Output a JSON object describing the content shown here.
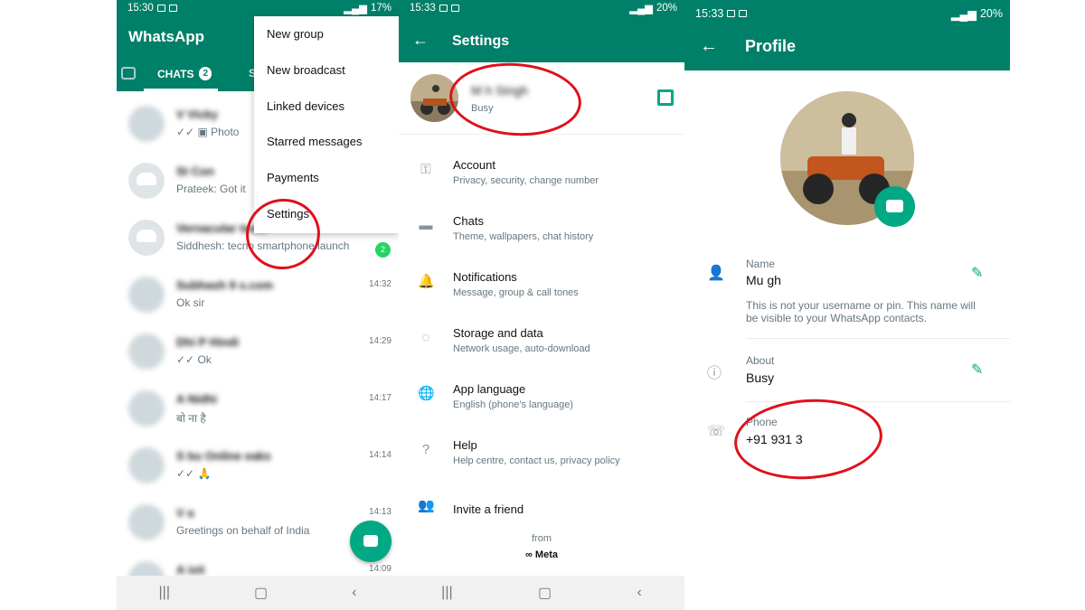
{
  "panel1": {
    "status_time": "15:30",
    "status_battery": "17%",
    "app_title": "WhatsApp",
    "tab_chats": "CHATS",
    "tab_chats_count": "2",
    "tab_partial": "S",
    "chats": [
      {
        "name": "V         Vicky",
        "msg": "✓✓ ▣ Photo",
        "time": ""
      },
      {
        "name": "St           Con",
        "msg": "Prateek: Got it",
        "time": ""
      },
      {
        "name": "Vernacular team",
        "msg": "Siddhesh: tecno smartphone launch",
        "time": "",
        "unread": "2"
      },
      {
        "name": "Subhash 9           s.com",
        "msg": "Ok sir",
        "time": "14:32"
      },
      {
        "name": "Dhi           P Hindi",
        "msg": "✓✓ Ok",
        "time": "14:29"
      },
      {
        "name": "A       Nidhi",
        "msg": "बो        ना है",
        "time": "14:17"
      },
      {
        "name": "S              bu Online       eaks",
        "msg": "✓✓ 🙏",
        "time": "14:14"
      },
      {
        "name": "V                           a",
        "msg": "Greetings on behalf of        India",
        "time": "14:13"
      },
      {
        "name": "A         ixit",
        "msg": "",
        "time": "14:09"
      }
    ],
    "menu": [
      "New group",
      "New broadcast",
      "Linked devices",
      "Starred messages",
      "Payments",
      "Settings"
    ]
  },
  "panel2": {
    "status_time": "15:33",
    "status_battery": "20%",
    "title": "Settings",
    "profile_name": "M      h Singh",
    "profile_status": "Busy",
    "items": [
      {
        "title": "Account",
        "sub": "Privacy, security, change number",
        "icon": "⚿"
      },
      {
        "title": "Chats",
        "sub": "Theme, wallpapers, chat history",
        "icon": "▬"
      },
      {
        "title": "Notifications",
        "sub": "Message, group & call tones",
        "icon": "🔔"
      },
      {
        "title": "Storage and data",
        "sub": "Network usage, auto-download",
        "icon": "◌"
      },
      {
        "title": "App language",
        "sub": "English (phone's language)",
        "icon": "🌐"
      },
      {
        "title": "Help",
        "sub": "Help centre, contact us, privacy policy",
        "icon": "?"
      },
      {
        "title": "Invite a friend",
        "sub": "",
        "icon": "👥"
      }
    ],
    "from": "from",
    "meta": "∞ Meta"
  },
  "panel3": {
    "status_time": "15:33",
    "status_battery": "20%",
    "title": "Profile",
    "name_label": "Name",
    "name_value": "Mu          gh",
    "name_note": "This is not your username or pin. This name will be visible to your WhatsApp contacts.",
    "about_label": "About",
    "about_value": "Busy",
    "phone_label": "Phone",
    "phone_value": "+91 931         3"
  }
}
